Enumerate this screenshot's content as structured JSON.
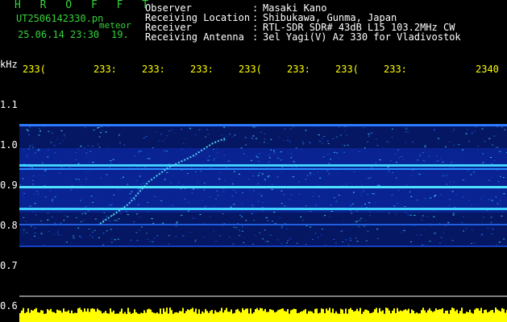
{
  "header": {
    "title": "H R O F F T",
    "filename": "UT2506142330.pn",
    "meteor_label": "meteor",
    "timestamp": "25.06.14 23:30",
    "count": "19.",
    "fields": [
      {
        "label": "Observer",
        "sep": ":",
        "value": "Masaki Kano"
      },
      {
        "label": "Receiving Location",
        "sep": ":",
        "value": "Shibukawa, Gunma, Japan"
      },
      {
        "label": "Receiver",
        "sep": ":",
        "value": "RTL-SDR SDR# 43dB L15 103.2MHz CW"
      },
      {
        "label": "Receiving Antenna",
        "sep": ":",
        "value": "3el Yagi(V) Az 330 for Vladivostok"
      }
    ]
  },
  "axes": {
    "y_unit": "kHz",
    "y_ticks": [
      "1.1",
      "1.0",
      "0.9",
      "0.8",
      "0.7",
      "0.6"
    ],
    "x_ticks": [
      "233(",
      "233:",
      "233:",
      "233:",
      "233(",
      "233:",
      "233(",
      "233:",
      "2340"
    ]
  },
  "colors": {
    "background": "#000000",
    "label_green": "#35d23a",
    "text_white": "#ffffff",
    "spectrum_low": "#061a6e",
    "spectrum_mid": "#1f6bff",
    "spectrum_high": "#39e6ff",
    "noise_bar": "#ffff00",
    "grid": "#ffffff"
  }
}
